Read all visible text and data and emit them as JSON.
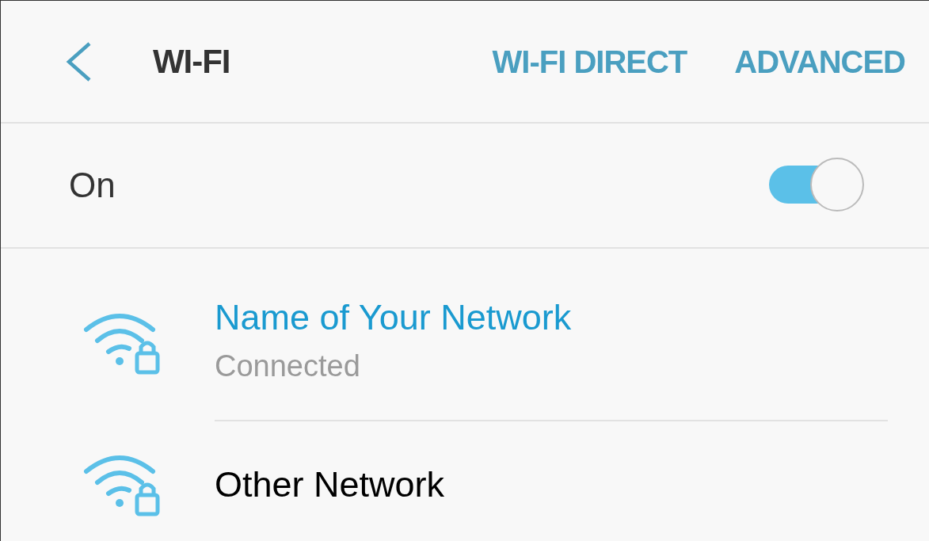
{
  "header": {
    "title": "WI-FI",
    "actions": [
      "WI-FI DIRECT",
      "ADVANCED"
    ]
  },
  "wifi_toggle": {
    "label": "On",
    "on": true
  },
  "networks": [
    {
      "name": "Name of Your Network",
      "status": "Connected",
      "selected": true
    },
    {
      "name": "Other Network",
      "selected": false
    }
  ]
}
